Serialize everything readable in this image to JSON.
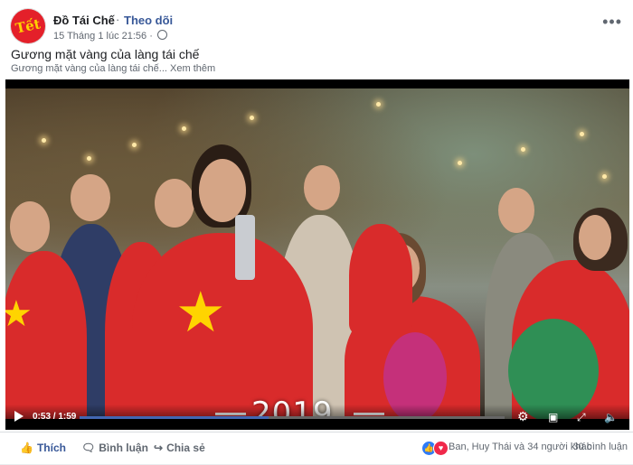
{
  "post": {
    "page_name": "Đồ Tái Chế",
    "separator": "·",
    "follow_label": "Theo dõi",
    "timestamp": "15 Tháng 1 lúc 21:56 ·",
    "avatar_text": "Tết",
    "title": "Gương mặt vàng của làng tái chế",
    "excerpt": "Gương mặt vàng của làng tái chế...",
    "see_more": "Xem thêm",
    "more_icon": "more-horizontal-icon"
  },
  "video": {
    "overlay_year": "2019",
    "current_time": "0:53",
    "duration": "1:59",
    "time_display": "0:53 / 1:59",
    "progress_fraction": 0.445,
    "accent_color": "#4267b2"
  },
  "actions": {
    "like_label": "Thích",
    "comment_label": "Bình luận",
    "share_label": "Chia sẻ"
  },
  "stats": {
    "reactions_text": "Ban, Huy Thái và 34 người khác",
    "comments_text": "30 bình luận"
  }
}
